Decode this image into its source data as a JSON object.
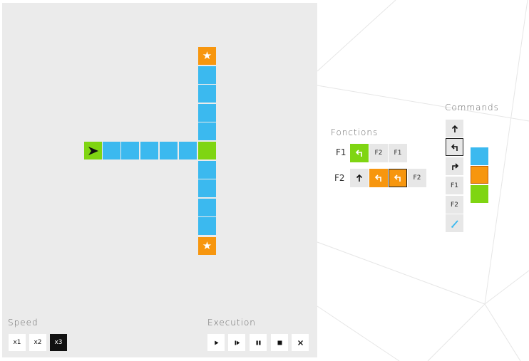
{
  "sections": {
    "speed_title": "Speed",
    "execution_title": "Execution",
    "functions_title": "Fonctions",
    "commands_title": "Commands"
  },
  "speed": {
    "options": [
      "x1",
      "x2",
      "x3"
    ],
    "selected": "x3"
  },
  "execution": {
    "buttons": [
      "play-icon",
      "step-icon",
      "pause-icon",
      "stop-icon",
      "clear-icon"
    ]
  },
  "functions": {
    "rows": [
      {
        "label": "F1",
        "slots": [
          {
            "icon": "turn-left-icon",
            "color": "green"
          },
          {
            "text": "F2",
            "color": "none"
          },
          {
            "text": "F1",
            "color": "none"
          }
        ]
      },
      {
        "label": "F2",
        "slots": [
          {
            "icon": "arrow-up-icon",
            "color": "none"
          },
          {
            "icon": "turn-left-icon",
            "color": "orange"
          },
          {
            "icon": "turn-left-icon",
            "color": "orange",
            "selected": true
          },
          {
            "text": "F2",
            "color": "none"
          }
        ]
      }
    ]
  },
  "commands": {
    "items": [
      {
        "icon": "arrow-up-icon"
      },
      {
        "icon": "turn-left-icon",
        "selected": true
      },
      {
        "icon": "turn-right-icon"
      },
      {
        "text": "F1"
      },
      {
        "text": "F2"
      },
      {
        "icon": "paint-brush-icon"
      }
    ],
    "colors": [
      {
        "name": "blue",
        "hex": "#3bb9ef"
      },
      {
        "name": "orange",
        "hex": "#f7960e",
        "selected": true
      },
      {
        "name": "green",
        "hex": "#7fd512"
      }
    ]
  },
  "palette": {
    "blue": "#3bb9ef",
    "orange": "#f7960e",
    "green": "#7fd512",
    "board_bg": "#ebebeb"
  },
  "board": {
    "robot": {
      "icon": "robot-arrow-icon",
      "facing": "right"
    },
    "stars_count": 2
  }
}
